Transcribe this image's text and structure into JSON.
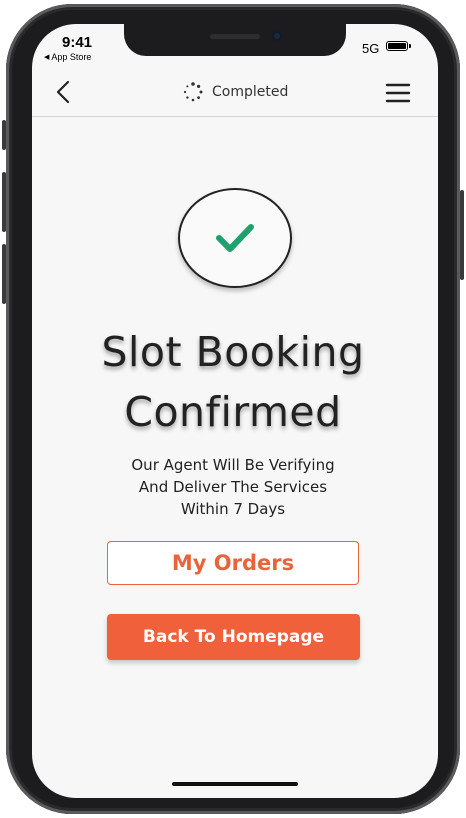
{
  "status_bar": {
    "time": "9:41",
    "back_app": "App Store",
    "network": "5G"
  },
  "nav": {
    "title": "Completed",
    "back_icon": "chevron-left-icon",
    "status_icon": "loading-spinner-icon",
    "menu_icon": "hamburger-menu-icon"
  },
  "confirmation": {
    "icon": "checkmark-icon",
    "headline_line1": "Slot Booking",
    "headline_line2": "Confirmed",
    "message_line1": "Our Agent Will Be Verifying",
    "message_line2": "And Deliver The Services",
    "message_line3": "Within 7 Days"
  },
  "actions": {
    "my_orders_label": "My Orders",
    "back_home_label": "Back To Homepage"
  },
  "colors": {
    "accent": "#f0603a",
    "check": "#1fa16b",
    "background": "#f7f7f7"
  }
}
